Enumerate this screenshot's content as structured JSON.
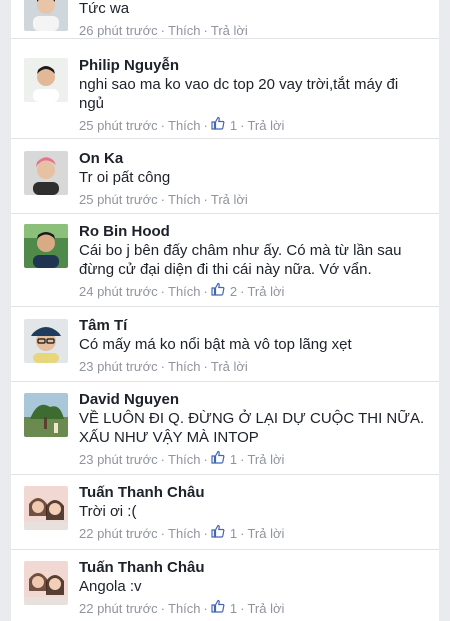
{
  "comments": [
    {
      "author": "",
      "text": "Tức wa",
      "time": "26 phút trước",
      "like_label": "Thích",
      "reply_label": "Trả lời",
      "like_count": null,
      "avatar": "avatar-young-man-white-shirt"
    },
    {
      "author": "Philip Nguyễn",
      "text": "nghi sao ma ko vao dc top 20 vay trời,tắt máy đi ngủ",
      "time": "25 phút trước",
      "like_label": "Thích",
      "reply_label": "Trả lời",
      "like_count": "1",
      "avatar": "avatar-young-man-pale-background"
    },
    {
      "author": "On Ka",
      "text": "Tr oi pất công",
      "time": "25 phút trước",
      "like_label": "Thích",
      "reply_label": "Trả lời",
      "like_count": null,
      "avatar": "avatar-pink-hair"
    },
    {
      "author": "Ro Bin Hood",
      "text": "Cái bo j bên đấy châm như ấy. Có mà từ lần sau đừng cử đại diện đi thi cái này nữa. Vớ vẩn.",
      "time": "24 phút trước",
      "like_label": "Thích",
      "reply_label": "Trả lời",
      "like_count": "2",
      "avatar": "avatar-man-green-background"
    },
    {
      "author": "Tâm Tí",
      "text": "Có mấy má ko nổi bật mà vô top lãng xẹt",
      "time": "23 phút trước",
      "like_label": "Thích",
      "reply_label": "Trả lời",
      "like_count": null,
      "avatar": "avatar-cap-glasses"
    },
    {
      "author": "David Nguyen",
      "text": "VỀ LUÔN ĐI Q. ĐỪNG Ở LẠI DỰ CUỘC THI NỮA. XẤU NHƯ VẬY MÀ INTOP",
      "time": "23 phút trước",
      "like_label": "Thích",
      "reply_label": "Trả lời",
      "like_count": "1",
      "avatar": "avatar-outdoor-tree"
    },
    {
      "author": "Tuấn Thanh Châu",
      "text": "Trời ơi :(",
      "time": "22 phút trước",
      "like_label": "Thích",
      "reply_label": "Trả lời",
      "like_count": "1",
      "avatar": "avatar-two-girls"
    },
    {
      "author": "Tuấn Thanh Châu",
      "text": "Angola :v",
      "time": "22 phút trước",
      "like_label": "Thích",
      "reply_label": "Trả lời",
      "like_count": "1",
      "avatar": "avatar-two-girls"
    }
  ],
  "colors": {
    "author": "#1d2129",
    "meta": "#90949c",
    "like_icon": "#4267b2",
    "background": "#e9ebee"
  }
}
